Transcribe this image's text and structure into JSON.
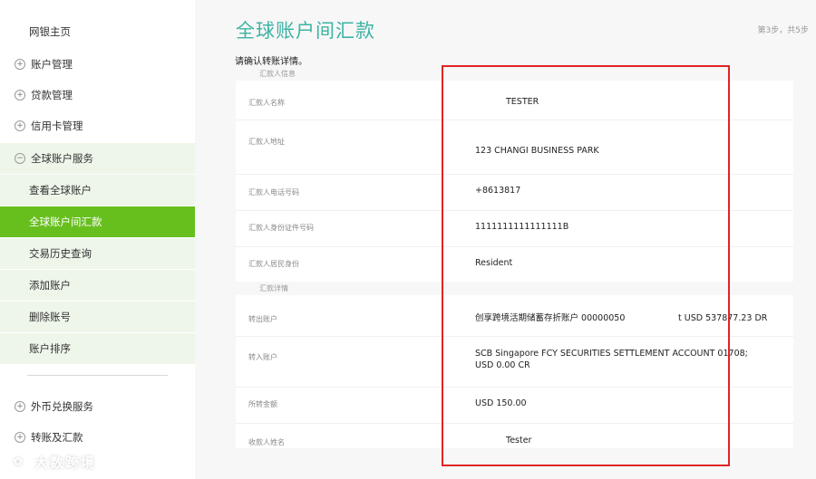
{
  "sidebar": {
    "home": "网银主页",
    "items": [
      {
        "label": "账户管理"
      },
      {
        "label": "贷款管理"
      },
      {
        "label": "信用卡管理"
      },
      {
        "label": "全球账户服务"
      }
    ],
    "sub_items": [
      {
        "label": "查看全球账户"
      },
      {
        "label": "全球账户间汇款"
      },
      {
        "label": "交易历史查询"
      },
      {
        "label": "添加账户"
      },
      {
        "label": "删除账号"
      },
      {
        "label": "账户排序"
      }
    ],
    "bottom_items": [
      {
        "label": "外币兑换服务"
      },
      {
        "label": "转账及汇款"
      }
    ]
  },
  "main": {
    "title": "全球账户间汇款",
    "step": "第3步，共5步",
    "subtitle": "请确认转账详情。",
    "sections": {
      "remitter": "汇款人信息",
      "transfer": "汇款详情"
    },
    "rows": [
      {
        "label": "汇款人名称",
        "value": "TESTER"
      },
      {
        "label": "汇款人地址",
        "value": "123 CHANGI BUSINESS PARK"
      },
      {
        "label": "汇款人电话号码",
        "value": "+8613817"
      },
      {
        "label": "汇款人身份证件号码",
        "value": "1111111111111111B"
      },
      {
        "label": "汇款人居民身份",
        "value": "Resident"
      },
      {
        "label": "转出账户",
        "value": "创享跨境活期储蓄存折账户 00000050",
        "extra": "t USD 537877.23 DR"
      },
      {
        "label": "转入账户",
        "value": "SCB Singapore FCY SECURITIES SETTLEMENT ACCOUNT 01708;\nUSD 0.00 CR"
      },
      {
        "label": "所转金额",
        "value": "USD 150.00"
      },
      {
        "label": "收款人姓名",
        "value": "Tester"
      }
    ]
  },
  "watermark": "大数跨境",
  "colors": {
    "accent_green": "#67bf1e",
    "title_teal": "#3db3a4",
    "highlight_red": "#e02424"
  }
}
